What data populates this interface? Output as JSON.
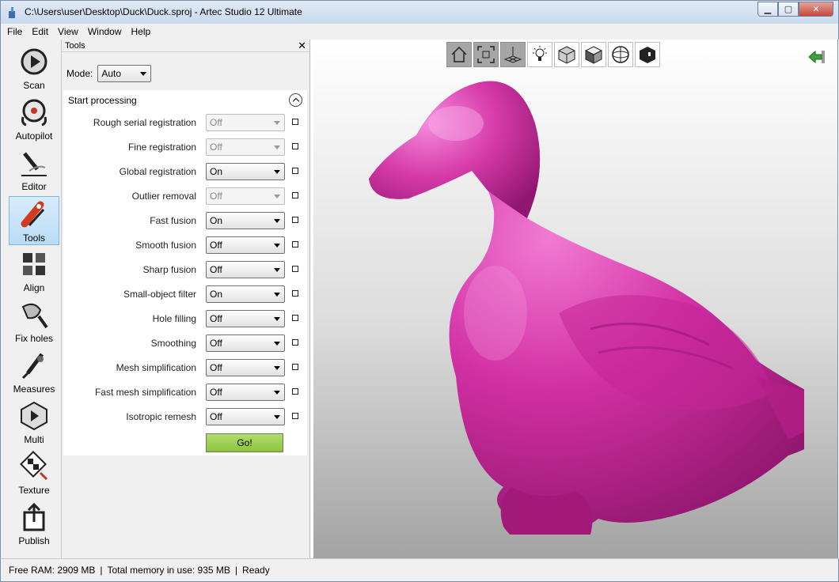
{
  "window": {
    "title": "C:\\Users\\user\\Desktop\\Duck\\Duck.sproj - Artec Studio 12 Ultimate"
  },
  "menu": [
    "File",
    "Edit",
    "View",
    "Window",
    "Help"
  ],
  "left_tools": [
    {
      "label": "Scan",
      "icon": "scan-icon"
    },
    {
      "label": "Autopilot",
      "icon": "autopilot-icon"
    },
    {
      "label": "Editor",
      "icon": "editor-icon"
    },
    {
      "label": "Tools",
      "icon": "tools-icon",
      "active": true
    },
    {
      "label": "Align",
      "icon": "align-icon"
    },
    {
      "label": "Fix holes",
      "icon": "fix-holes-icon"
    },
    {
      "label": "Measures",
      "icon": "measures-icon"
    },
    {
      "label": "Multi",
      "icon": "multi-icon"
    },
    {
      "label": "Texture",
      "icon": "texture-icon"
    },
    {
      "label": "Publish",
      "icon": "publish-icon"
    }
  ],
  "panel": {
    "title": "Tools",
    "close": "✕",
    "mode_label": "Mode:",
    "mode_value": "Auto",
    "section_title": "Start processing",
    "rows": [
      {
        "label": "Rough serial registration",
        "value": "Off",
        "disabled": true
      },
      {
        "label": "Fine registration",
        "value": "Off",
        "disabled": true
      },
      {
        "label": "Global registration",
        "value": "On",
        "disabled": false
      },
      {
        "label": "Outlier removal",
        "value": "Off",
        "disabled": true
      },
      {
        "label": "Fast fusion",
        "value": "On",
        "disabled": false
      },
      {
        "label": "Smooth fusion",
        "value": "Off",
        "disabled": false
      },
      {
        "label": "Sharp fusion",
        "value": "Off",
        "disabled": false
      },
      {
        "label": "Small-object filter",
        "value": "On",
        "disabled": false
      },
      {
        "label": "Hole filling",
        "value": "Off",
        "disabled": false
      },
      {
        "label": "Smoothing",
        "value": "Off",
        "disabled": false
      },
      {
        "label": "Mesh simplification",
        "value": "Off",
        "disabled": false
      },
      {
        "label": "Fast mesh simplification",
        "value": "Off",
        "disabled": false
      },
      {
        "label": "Isotropic remesh",
        "value": "Off",
        "disabled": false
      }
    ],
    "go_label": "Go!"
  },
  "viewport": {
    "toolbar": [
      "home-icon",
      "fit-view-icon",
      "grid-icon",
      "light-icon",
      "textured-cube-icon",
      "solid-cube-icon",
      "sphere-icon",
      "dark-cube-icon"
    ],
    "model_color": "#d12fa3"
  },
  "status": {
    "free_ram": "Free RAM: 2909 MB",
    "total_memory": "Total memory in use: 935 MB",
    "state": "Ready"
  }
}
